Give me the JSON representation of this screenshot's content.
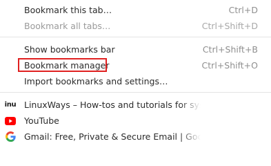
{
  "menu": {
    "items": [
      {
        "label": "Bookmark this tab…",
        "shortcut": "Ctrl+D"
      },
      {
        "label": "Bookmark all tabs…",
        "shortcut": "Ctrl+Shift+D"
      },
      {
        "label": "Show bookmarks bar",
        "shortcut": "Ctrl+Shift+B"
      },
      {
        "label": "Bookmark manager",
        "shortcut": "Ctrl+Shift+O"
      },
      {
        "label": "Import bookmarks and settings…"
      }
    ],
    "bookmarks": [
      {
        "title": "LinuxWays – How-tos and tutorials for sys ad",
        "icon": "linuxways-favicon",
        "icon_text": "inu"
      },
      {
        "title": "YouTube",
        "icon": "youtube-favicon"
      },
      {
        "title": "Gmail: Free, Private & Secure Email | Google",
        "icon": "google-favicon"
      }
    ]
  },
  "colors": {
    "highlight": "#e02020",
    "youtube": "#ff0000"
  }
}
